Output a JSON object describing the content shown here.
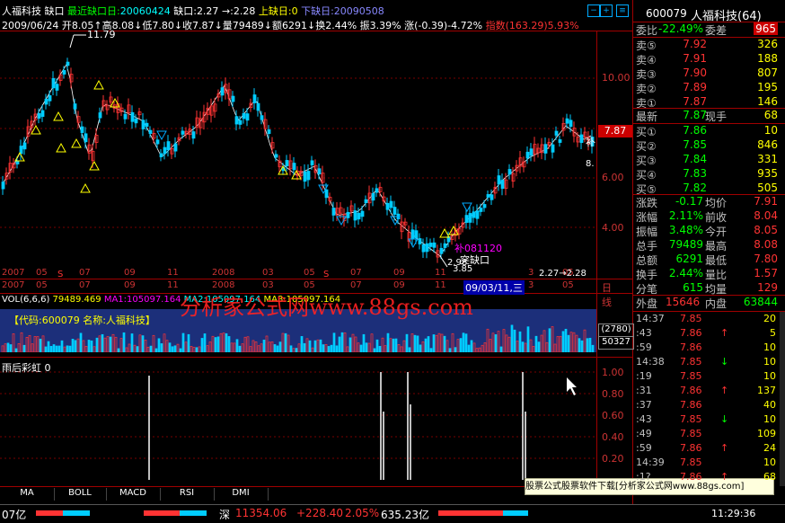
{
  "header": {
    "stock_name": "人福科技",
    "mode": "缺口",
    "recent_gap_label": "最近缺口日:",
    "recent_gap_date": "20060424",
    "gap_label": "缺口:",
    "gap_value": "2.27",
    "gap_arrow": "→:2.28",
    "upper_gap": "上缺日:0",
    "lower_gap_label": "下缺日:",
    "lower_gap_date": "20090508",
    "quote_line": {
      "date": "2009/06/24",
      "open": "开8.05",
      "high": "↑高8.08",
      "low": "↓低7.80",
      "close": "↓收7.87",
      "vol": "↓量79489",
      "amount": "↓额6291",
      "turnover": "↓换2.44%",
      "amp": "振3.39%",
      "chg": "涨(-0.39)-4.72%",
      "index": "指数(163.29)5.93%"
    }
  },
  "price_chart": {
    "y_labels": [
      "10.00",
      "8.00",
      "6.00",
      "4.00"
    ],
    "high_label": "11.79",
    "cur_price": "7.87",
    "annot1": "补081120",
    "annot2": "突缺口",
    "low1": "2.98",
    "low2": "3.85",
    "gap_text": "2.27→2.28",
    "right_mark": "补",
    "right_mark2": "8.",
    "x_labels": [
      "2007",
      "05",
      "07",
      "09",
      "11",
      "2008",
      "03",
      "05",
      "07",
      "09",
      "11",
      "09/03/11,三",
      "3",
      "05"
    ],
    "day_label": "日线"
  },
  "volume": {
    "title": "VOL(6,6,6)",
    "v": "79489.469",
    "ma1": "MA1:105097.164",
    "ma2": "MA2:105097.164",
    "ma3": "MA3:105097.164",
    "code_label": "【代码:600079 名称:人福科技】",
    "right_top": "(2780)",
    "right_bot": "50327",
    "watermark": "分析家公式网www.88gs.com"
  },
  "indicator": {
    "title": "雨后彩虹 0",
    "y_labels": [
      "1.00",
      "0.80",
      "0.60",
      "0.40",
      "0.20"
    ]
  },
  "tabs": [
    "MA",
    "BOLL",
    "MACD",
    "RSI",
    "DMI"
  ],
  "ad_text": "股票公式股票软件下载[分析家公式网www.88gs.com]",
  "status": {
    "left": "07亿",
    "market": "深",
    "index": "11354.06",
    "chg": "+228.40",
    "pct": "2.05%",
    "amount": "635.23亿",
    "time": "11:29:36"
  },
  "right_panel": {
    "code": "600079",
    "name": "人福科技(64)",
    "weibi_label": "委比",
    "weibi": "-22.49%",
    "weicha_label": "委差",
    "weicha": "965",
    "asks": [
      {
        "label": "卖⑤",
        "price": "7.92",
        "vol": "326"
      },
      {
        "label": "卖④",
        "price": "7.91",
        "vol": "188"
      },
      {
        "label": "卖③",
        "price": "7.90",
        "vol": "807"
      },
      {
        "label": "卖②",
        "price": "7.89",
        "vol": "195"
      },
      {
        "label": "卖①",
        "price": "7.87",
        "vol": "146"
      }
    ],
    "last_label": "最新",
    "last": "7.87",
    "now_label": "现手",
    "now": "68",
    "bids": [
      {
        "label": "买①",
        "price": "7.86",
        "vol": "10"
      },
      {
        "label": "买②",
        "price": "7.85",
        "vol": "846"
      },
      {
        "label": "买③",
        "price": "7.84",
        "vol": "331"
      },
      {
        "label": "买④",
        "price": "7.83",
        "vol": "935"
      },
      {
        "label": "买⑤",
        "price": "7.82",
        "vol": "505"
      }
    ],
    "stats": [
      {
        "l1": "涨跌",
        "v1": "-0.17",
        "l2": "均价",
        "v2": "7.91"
      },
      {
        "l1": "涨幅",
        "v1": "2.11%",
        "l2": "前收",
        "v2": "8.04"
      },
      {
        "l1": "振幅",
        "v1": "3.48%",
        "l2": "今开",
        "v2": "8.05"
      },
      {
        "l1": "总手",
        "v1": "79489",
        "l2": "最高",
        "v2": "8.08"
      },
      {
        "l1": "总额",
        "v1": "6291",
        "l2": "最低",
        "v2": "7.80"
      },
      {
        "l1": "换手",
        "v1": "2.44%",
        "l2": "量比",
        "v2": "1.57"
      },
      {
        "l1": "分笔",
        "v1": "615",
        "l2": "均量",
        "v2": "129"
      }
    ],
    "outer_label": "外盘",
    "outer": "15646",
    "inner_label": "内盘",
    "inner": "63844",
    "ticks": [
      {
        "t": "14:37",
        "p": "7.85",
        "a": "",
        "v": "20"
      },
      {
        "t": ":43",
        "p": "7.86",
        "a": "↑",
        "v": "5"
      },
      {
        "t": ":59",
        "p": "7.86",
        "a": "",
        "v": "10"
      },
      {
        "t": "14:38",
        "p": "7.85",
        "a": "↓",
        "v": "10"
      },
      {
        "t": ":19",
        "p": "7.85",
        "a": "",
        "v": "10"
      },
      {
        "t": ":31",
        "p": "7.86",
        "a": "↑",
        "v": "137"
      },
      {
        "t": ":37",
        "p": "7.86",
        "a": "",
        "v": "40"
      },
      {
        "t": ":43",
        "p": "7.85",
        "a": "↓",
        "v": "10"
      },
      {
        "t": ":49",
        "p": "7.85",
        "a": "",
        "v": "109"
      },
      {
        "t": ":59",
        "p": "7.86",
        "a": "↑",
        "v": "24"
      },
      {
        "t": "14:39",
        "p": "7.85",
        "a": "",
        "v": "10"
      },
      {
        "t": ":1?",
        "p": "7.86",
        "a": "↑",
        "v": "68"
      }
    ]
  },
  "colors": {
    "red": "#ff3333",
    "green": "#00ff00",
    "yellow": "#ffff00",
    "cyan": "#00ffff",
    "frame": "#a00000"
  }
}
